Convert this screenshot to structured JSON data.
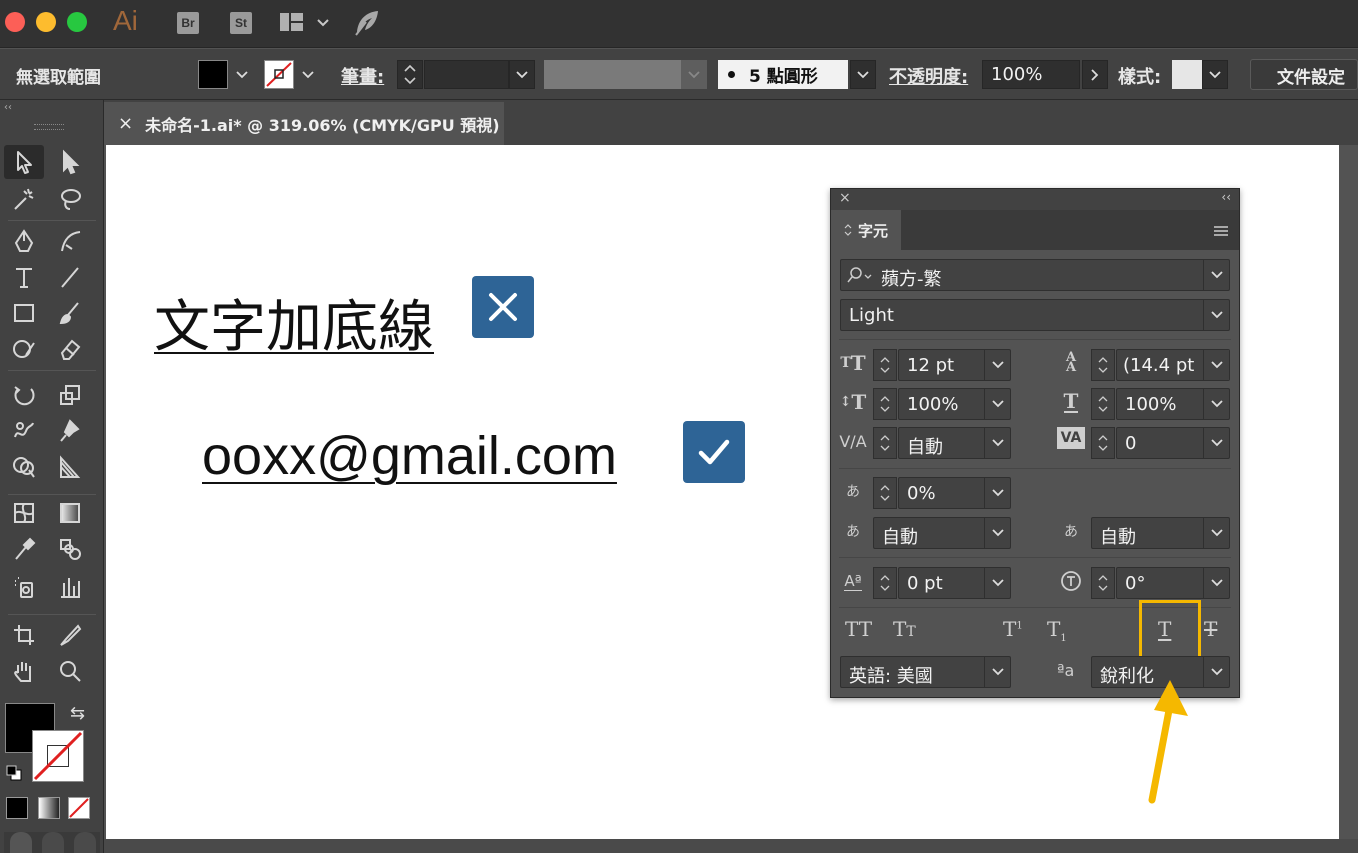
{
  "titlebar": {
    "app_logo": "Ai",
    "bridge_badge": "Br",
    "stock_badge": "St",
    "icons": [
      "workspace-layout-icon",
      "feather-icon"
    ]
  },
  "controlbar": {
    "selection_label": "無選取範圍",
    "stroke_label": "筆畫:",
    "brush_value": "5 點圓形",
    "opacity_label": "不透明度:",
    "opacity_value": "100%",
    "style_label": "樣式:",
    "doc_settings_button": "文件設定"
  },
  "tab": {
    "close": "×",
    "title": "未命名-1.ai* @ 319.06% (CMYK/GPU 預視)"
  },
  "canvas": {
    "heading": "文字加底線",
    "email": "ooxx@gmail.com"
  },
  "char_panel": {
    "tab_label": "字元",
    "font_family": "蘋方-繁",
    "font_style": "Light",
    "font_size": "12 pt",
    "leading": "(14.4 pt",
    "vertical_scale": "100%",
    "horizontal_scale": "100%",
    "kerning": "自動",
    "tracking": "0",
    "tsume": "0%",
    "aki_left": "自動",
    "aki_right": "自動",
    "baseline_shift": "0 pt",
    "rotation": "0°",
    "language": "英語: 美國",
    "antialias": "銳利化",
    "aa_icon": "ªa"
  },
  "highlight_color": "#f5b800",
  "accent_box_color": "#2e6496"
}
